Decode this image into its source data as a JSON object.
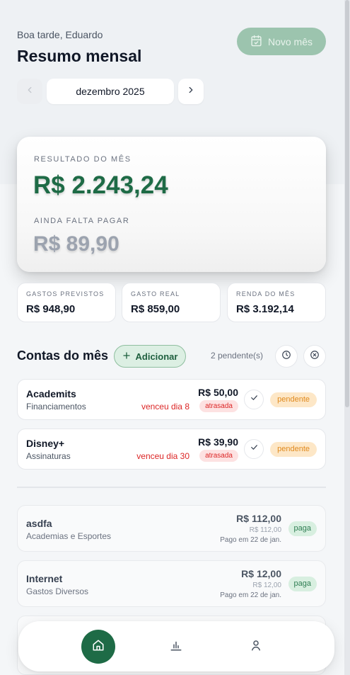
{
  "header": {
    "greeting": "Boa tarde, Eduardo",
    "title": "Resumo mensal",
    "new_month_button": "Novo mês"
  },
  "month_nav": {
    "current_month": "dezembro 2025"
  },
  "summary": {
    "result_label": "RESULTADO DO MÊS",
    "result_value": "R$ 2.243,24",
    "remaining_label": "AINDA FALTA PAGAR",
    "remaining_value": "R$ 89,90"
  },
  "stats": [
    {
      "label": "GASTOS PREVISTOS",
      "value": "R$ 948,90"
    },
    {
      "label": "GASTO REAL",
      "value": "R$ 859,00"
    },
    {
      "label": "RENDA DO MÊS",
      "value": "R$ 3.192,14"
    }
  ],
  "bills_section": {
    "title": "Contas do mês",
    "add_button": "Adicionar",
    "pending_count": "2 pendente(s)"
  },
  "pending_bills": [
    {
      "name": "Academits",
      "category": "Financiamentos",
      "amount": "R$ 50,00",
      "due": "venceu dia 8",
      "late": "atrasada",
      "status": "pendente"
    },
    {
      "name": "Disney+",
      "category": "Assinaturas",
      "amount": "R$ 39,90",
      "due": "venceu dia 30",
      "late": "atrasada",
      "status": "pendente"
    }
  ],
  "paid_bills": [
    {
      "name": "asdfa",
      "category": "Academias e Esportes",
      "amount": "R$ 112,00",
      "planned": "R$ 112,00",
      "paid_on": "Pago em 22 de jan.",
      "status": "paga"
    },
    {
      "name": "Internet",
      "category": "Gastos Diversos",
      "amount": "R$ 12,00",
      "planned": "R$ 12,00",
      "paid_on": "Pago em 22 de jan.",
      "status": "paga"
    }
  ],
  "icons": {
    "new_month": "calendar-check-icon",
    "prev": "chevron-left-icon",
    "next": "chevron-right-icon",
    "add": "plus-icon",
    "history": "clock-icon",
    "clear": "x-circle-icon",
    "mark_paid": "check-icon",
    "home": "home-icon",
    "charts": "bar-chart-icon",
    "profile": "user-icon"
  },
  "colors": {
    "brand_green": "#1e6b46",
    "pending_orange": "#e08a1e",
    "late_red": "#dc2626",
    "paid_green": "#2e7d52"
  }
}
